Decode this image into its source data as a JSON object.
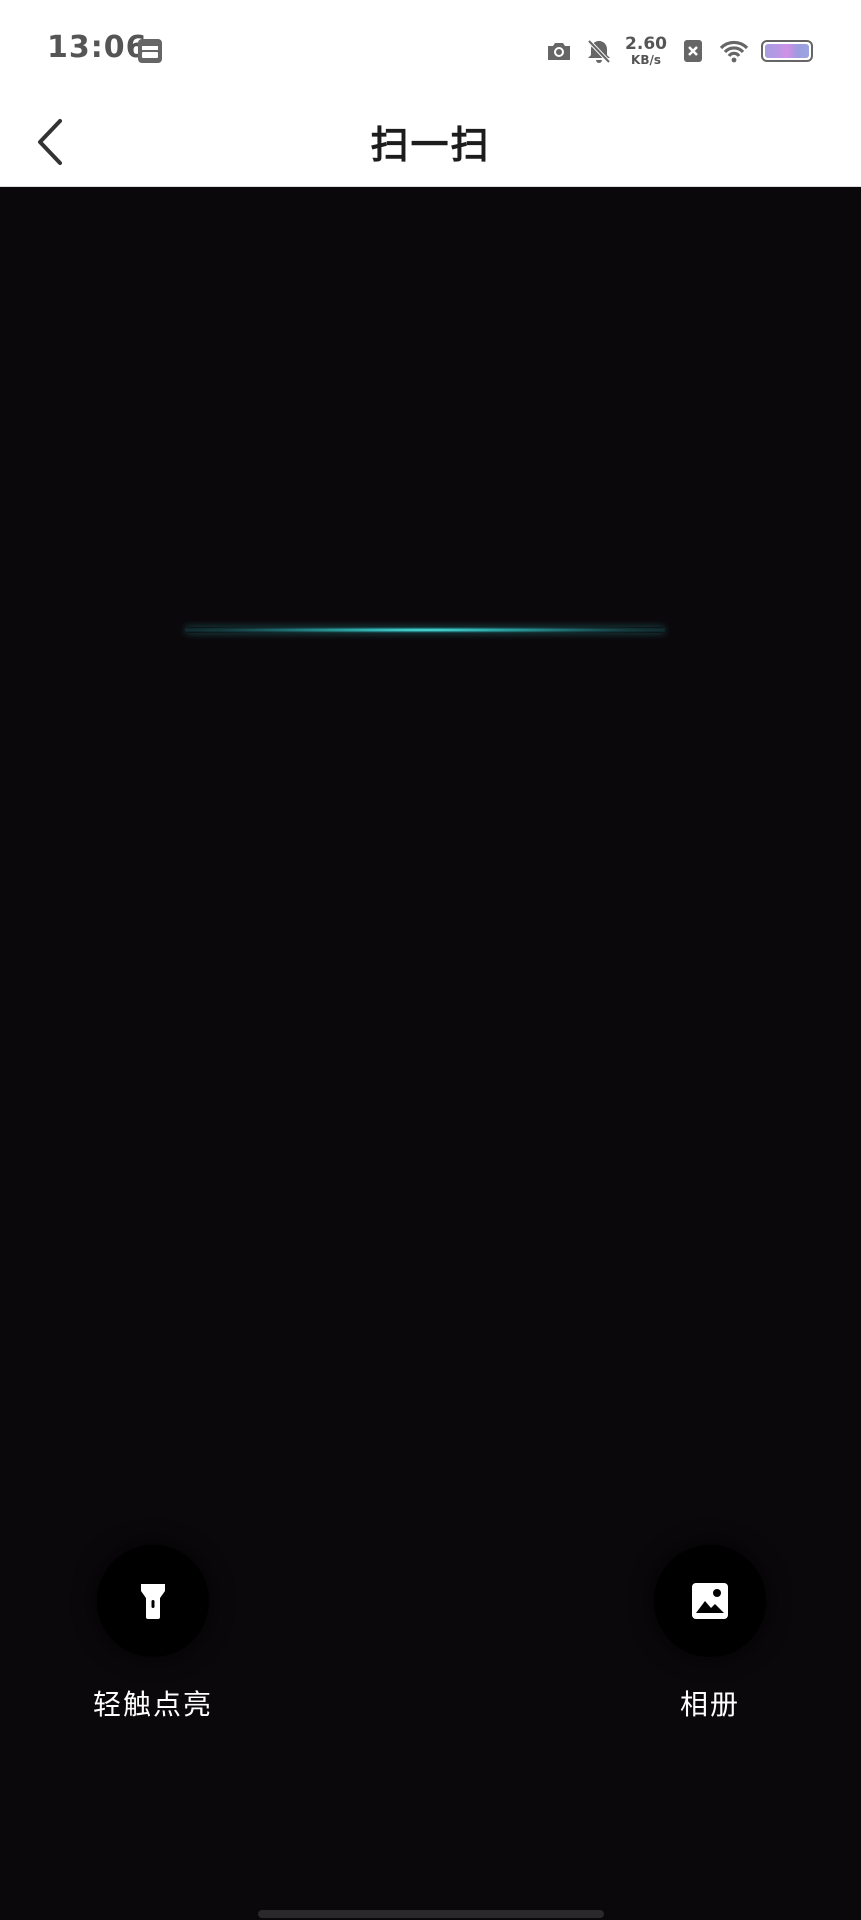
{
  "status_bar": {
    "time": "13:06",
    "net_speed_value": "2.60",
    "net_speed_unit": "KB/s",
    "icons": [
      "calendar-icon",
      "camera-icon",
      "bell-muted-icon",
      "close-box-icon",
      "wifi-icon",
      "battery-icon"
    ]
  },
  "header": {
    "title": "扫一扫",
    "back_icon": "chevron-left-icon"
  },
  "scanner": {
    "scan_line_color": "#3fd6d0",
    "background_color": "#0b080b"
  },
  "tools": {
    "flashlight": {
      "label": "轻触点亮",
      "icon": "flashlight-icon"
    },
    "album": {
      "label": "相册",
      "icon": "image-icon"
    }
  }
}
